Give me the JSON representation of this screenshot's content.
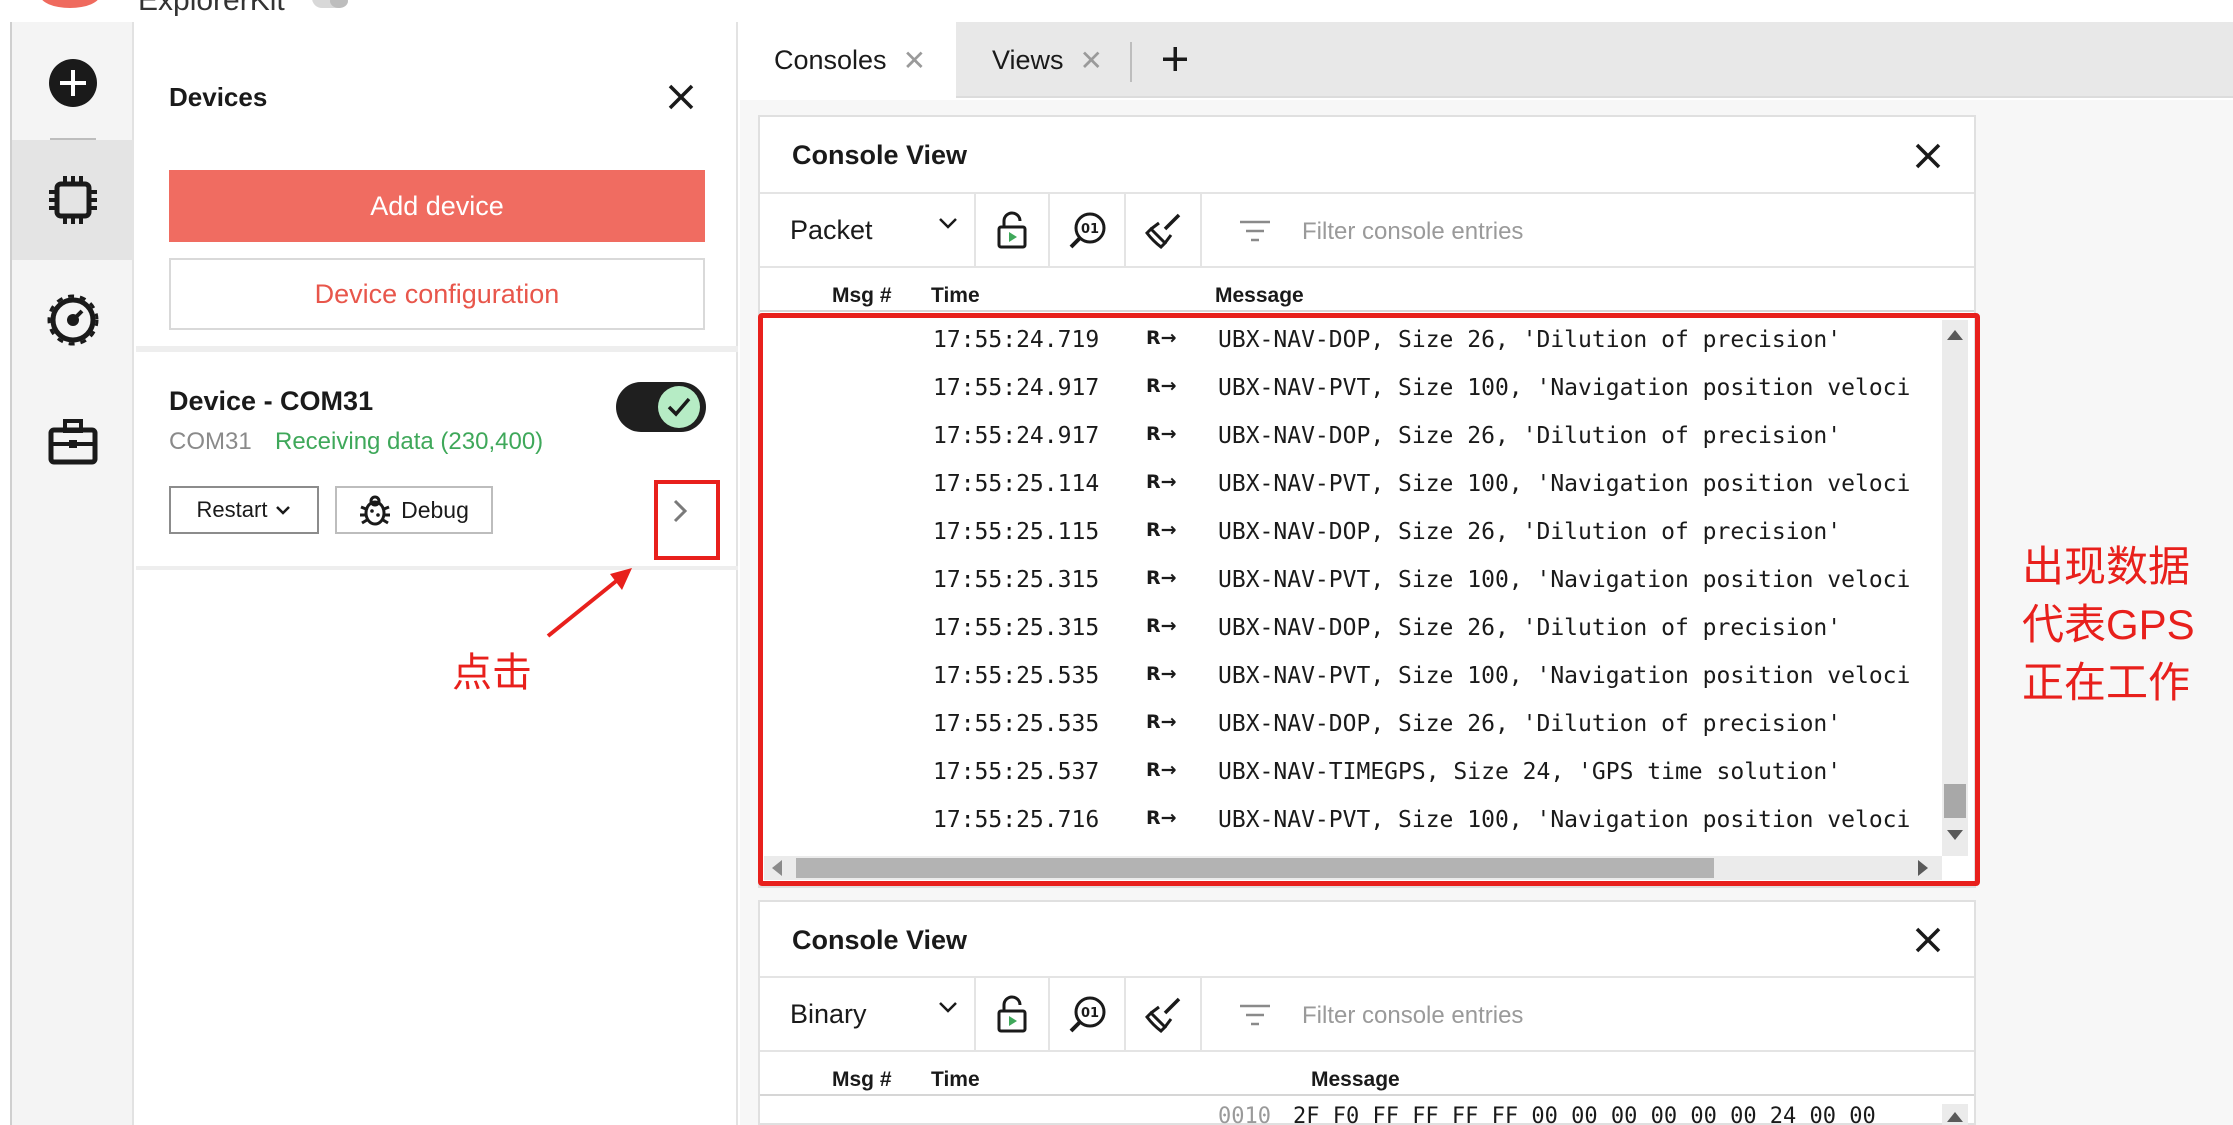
{
  "app": {
    "title": "ExplorerKit"
  },
  "rail": {
    "items": [
      {
        "name": "add",
        "icon": "plus-circle-icon"
      },
      {
        "name": "devices",
        "icon": "chip-icon",
        "active": true
      },
      {
        "name": "tools",
        "icon": "gauge-icon"
      },
      {
        "name": "kit",
        "icon": "briefcase-icon"
      }
    ]
  },
  "devices_panel": {
    "title": "Devices",
    "add_device_label": "Add device",
    "device_config_label": "Device configuration",
    "device": {
      "name": "Device - COM31",
      "port": "COM31",
      "status": "Receiving data (230,400)",
      "enabled": true,
      "restart_label": "Restart",
      "debug_label": "Debug"
    }
  },
  "tabs": [
    {
      "label": "Consoles",
      "active": true
    },
    {
      "label": "Views",
      "active": false
    }
  ],
  "console1": {
    "title": "Console View",
    "mode": "Packet",
    "filter_placeholder": "Filter console entries",
    "columns": {
      "msg": "Msg #",
      "time": "Time",
      "message": "Message"
    },
    "rows": [
      {
        "time": "17:55:24.719",
        "dir": "R→",
        "message": "UBX-NAV-DOP, Size 26, 'Dilution of precision'"
      },
      {
        "time": "17:55:24.917",
        "dir": "R→",
        "message": "UBX-NAV-PVT, Size 100, 'Navigation position veloci"
      },
      {
        "time": "17:55:24.917",
        "dir": "R→",
        "message": "UBX-NAV-DOP, Size 26, 'Dilution of precision'"
      },
      {
        "time": "17:55:25.114",
        "dir": "R→",
        "message": "UBX-NAV-PVT, Size 100, 'Navigation position veloci"
      },
      {
        "time": "17:55:25.115",
        "dir": "R→",
        "message": "UBX-NAV-DOP, Size 26, 'Dilution of precision'"
      },
      {
        "time": "17:55:25.315",
        "dir": "R→",
        "message": "UBX-NAV-PVT, Size 100, 'Navigation position veloci"
      },
      {
        "time": "17:55:25.315",
        "dir": "R→",
        "message": "UBX-NAV-DOP, Size 26, 'Dilution of precision'"
      },
      {
        "time": "17:55:25.535",
        "dir": "R→",
        "message": "UBX-NAV-PVT, Size 100, 'Navigation position veloci"
      },
      {
        "time": "17:55:25.535",
        "dir": "R→",
        "message": "UBX-NAV-DOP, Size 26, 'Dilution of precision'"
      },
      {
        "time": "17:55:25.537",
        "dir": "R→",
        "message": "UBX-NAV-TIMEGPS, Size 24, 'GPS time solution'"
      },
      {
        "time": "17:55:25.716",
        "dir": "R→",
        "message": "UBX-NAV-PVT, Size 100, 'Navigation position veloci"
      }
    ]
  },
  "console2": {
    "title": "Console View",
    "mode": "Binary",
    "filter_placeholder": "Filter console entries",
    "columns": {
      "msg": "Msg #",
      "time": "Time",
      "message": "Message"
    },
    "hex_offset": "0010",
    "hex_bytes": "2F F0 FF FF FF FF 00 00 00 00 00 00 24 00 00"
  },
  "annotations": {
    "click_label": "点击",
    "note_lines": [
      "出现数据",
      "代表GPS",
      "正在工作"
    ],
    "color": "#e8201c"
  },
  "colors": {
    "accent": "#f06c61",
    "status_green": "#3fa85a",
    "toggle_knob": "#b6ecc5"
  }
}
